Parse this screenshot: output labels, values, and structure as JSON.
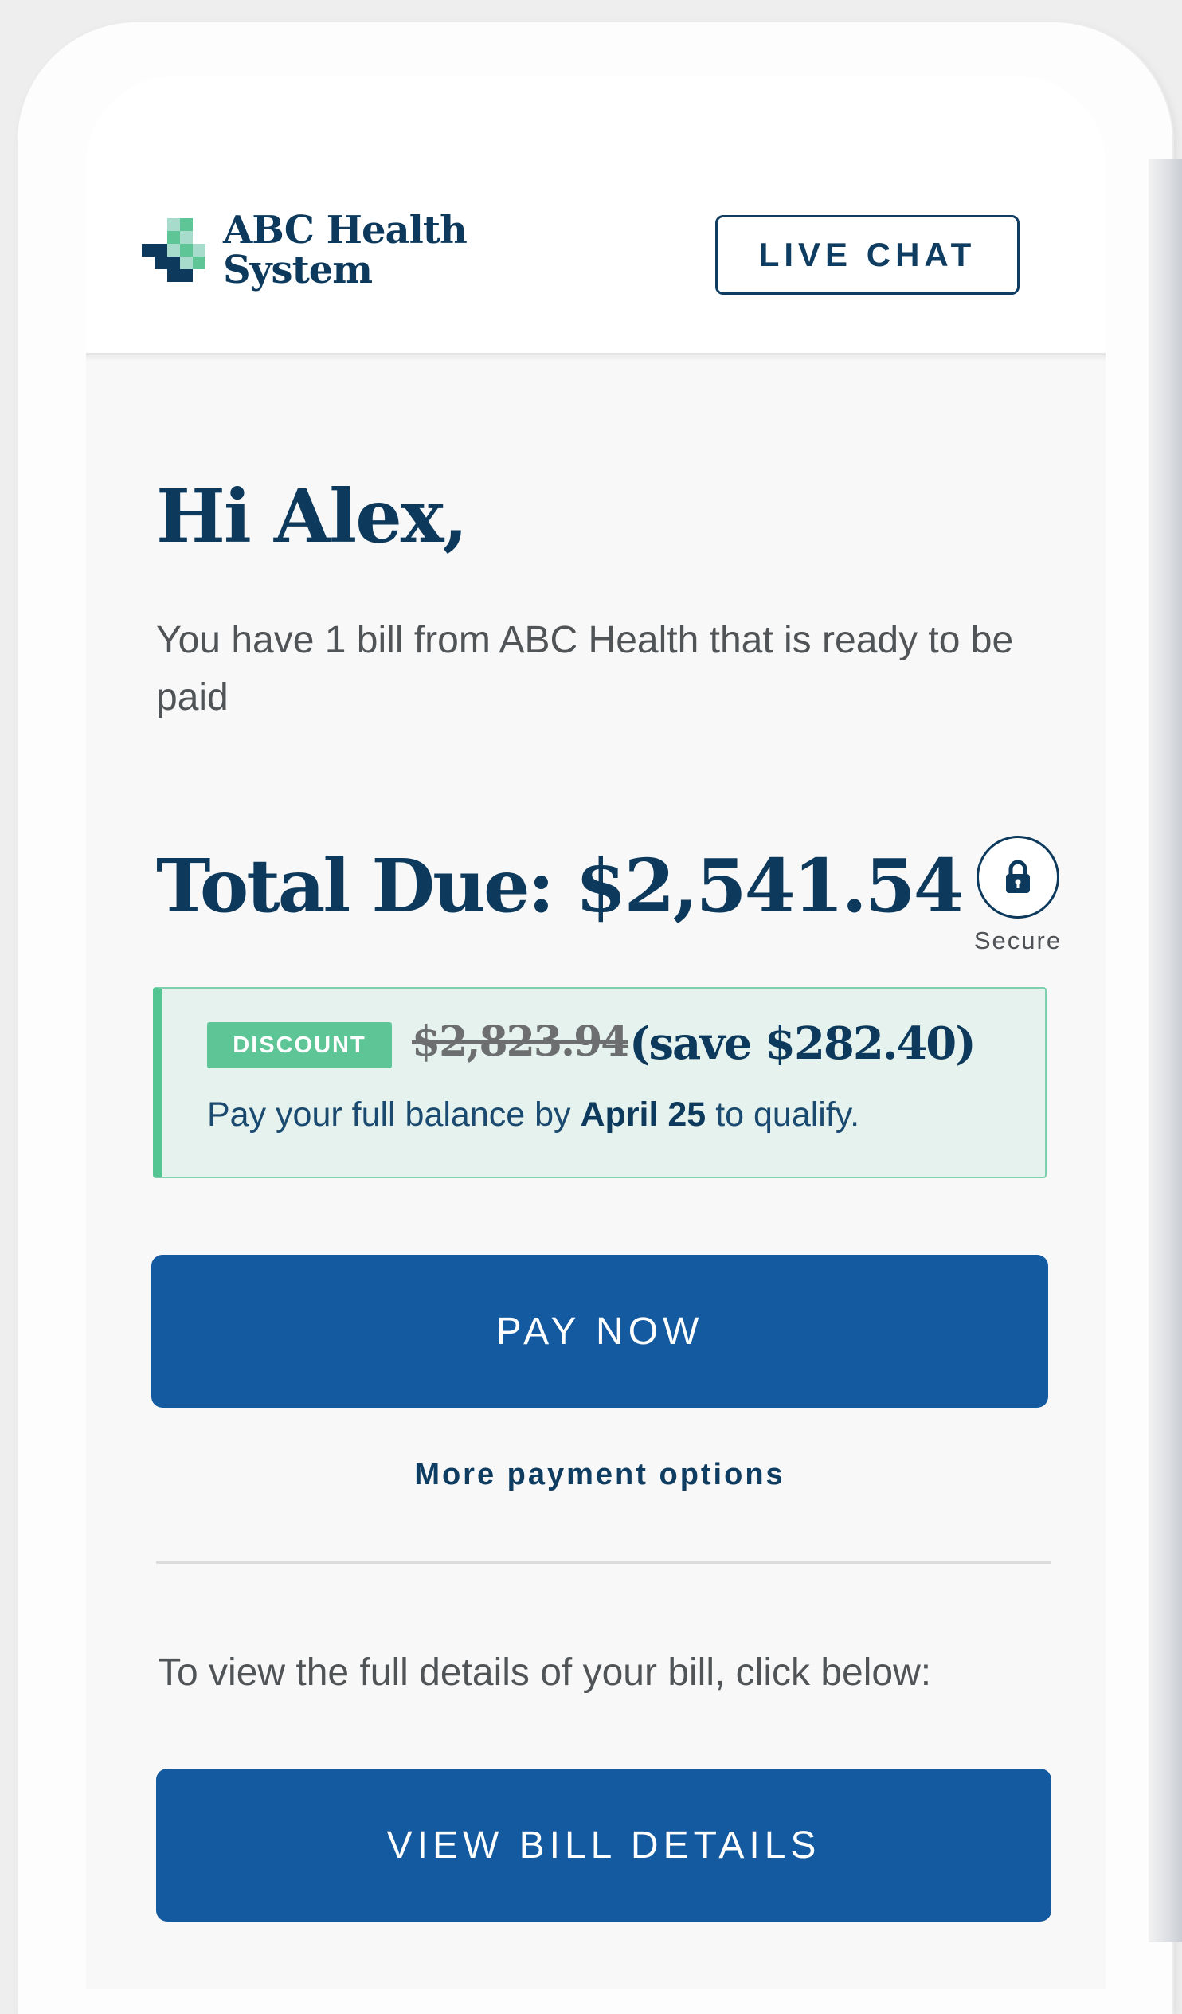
{
  "brand": {
    "name_line1": "ABC Health",
    "name_line2": "System",
    "logo_icon": "medical-cross-icon",
    "colors": {
      "navy": "#0d3a5c",
      "teal": "#5ec596",
      "light_teal": "#a7dccd",
      "primary": "#145aa0"
    }
  },
  "header": {
    "live_chat_label": "LIVE CHAT"
  },
  "main": {
    "greeting": "Hi Alex,",
    "intro": "You have 1 bill from ABC Health that is ready to be paid",
    "total_due": "Total Due: $2,541.54",
    "secure_label": "Secure",
    "secure_icon": "lock-icon"
  },
  "discount": {
    "badge": "DISCOUNT",
    "original_amount": "$2,823.94",
    "savings": "(save $282.40)",
    "qualify_prefix": "Pay your full balance by",
    "qualify_date": "April 25",
    "qualify_suffix": "to qualify."
  },
  "actions": {
    "pay_now_label": "PAY NOW",
    "more_options_label": "More payment options",
    "view_details_text": "To view the full details of your bill, click below:",
    "view_bill_label": "VIEW BILL DETAILS"
  }
}
